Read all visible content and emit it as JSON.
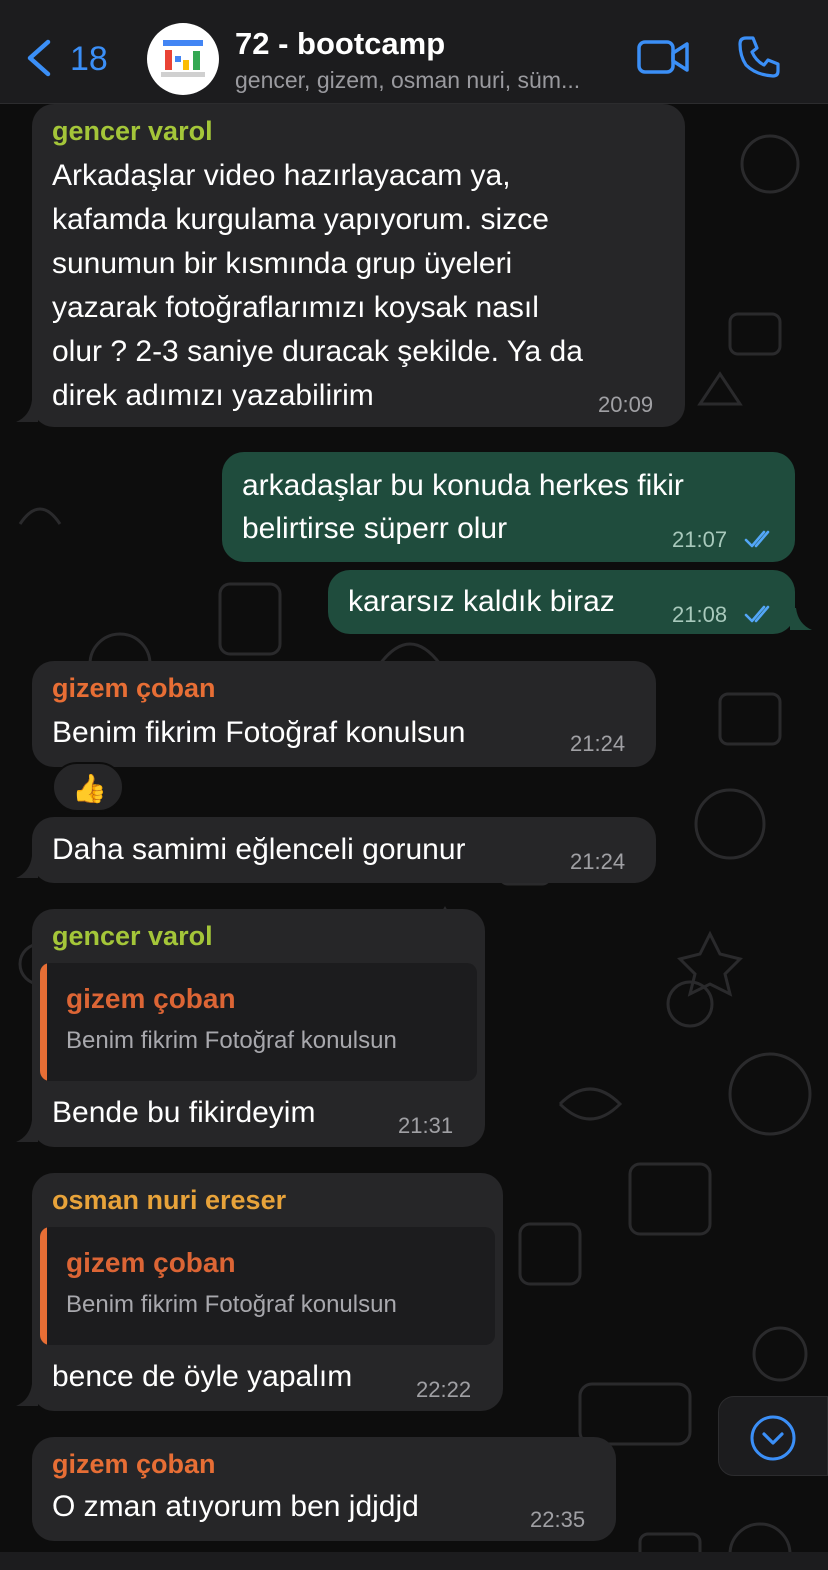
{
  "header": {
    "back_count": "18",
    "title": "72 - bootcamp",
    "members": "gencer, gizem, osman nuri, süm...",
    "accent_color": "#3b8ff7"
  },
  "messages": [
    {
      "sender": "gencer varol",
      "sender_color": "#a4c639",
      "lines": [
        "Arkadaşlar video hazırlayacam ya,",
        "kafamda kurgulama yapıyorum. sizce",
        "sunumun bir kısmında grup üyeleri",
        "yazarak fotoğraflarımızı koysak nasıl",
        "olur ? 2-3 saniye duracak şekilde. Ya da",
        "direk adımızı yazabilirim"
      ],
      "time": "20:09"
    },
    {
      "outgoing": true,
      "lines": [
        "arkadaşlar bu konuda herkes fikir",
        "belirtirse süperr olur"
      ],
      "time": "21:07",
      "status": "read"
    },
    {
      "outgoing": true,
      "lines": [
        "kararsız kaldık biraz"
      ],
      "time": "21:08",
      "status": "read"
    },
    {
      "sender": "gizem çoban",
      "sender_color": "#e76e35",
      "lines": [
        "Benim fikrim Fotoğraf konulsun"
      ],
      "time": "21:24",
      "reaction": "👍"
    },
    {
      "lines": [
        "Daha samimi eğlenceli gorunur"
      ],
      "time": "21:24"
    },
    {
      "sender": "gencer varol",
      "sender_color": "#a4c639",
      "quote": {
        "sender": "gizem çoban",
        "text": "Benim fikrim Fotoğraf konulsun"
      },
      "lines": [
        "Bende bu fikirdeyim"
      ],
      "time": "21:31"
    },
    {
      "sender": "osman nuri ereser",
      "sender_color": "#e8a33a",
      "quote": {
        "sender": "gizem çoban",
        "text": "Benim fikrim Fotoğraf konulsun"
      },
      "lines": [
        "bence de öyle yapalım"
      ],
      "time": "22:22"
    },
    {
      "sender": "gizem çoban",
      "sender_color": "#e76e35",
      "lines": [
        "O zman atıyorum ben jdjdjd"
      ],
      "time": "22:35"
    }
  ],
  "icons": {
    "back": "chevron-left-icon",
    "video": "video-camera-icon",
    "phone": "phone-icon",
    "read_receipt": "double-check-icon",
    "scroll_down": "chevron-down-circle-icon"
  }
}
